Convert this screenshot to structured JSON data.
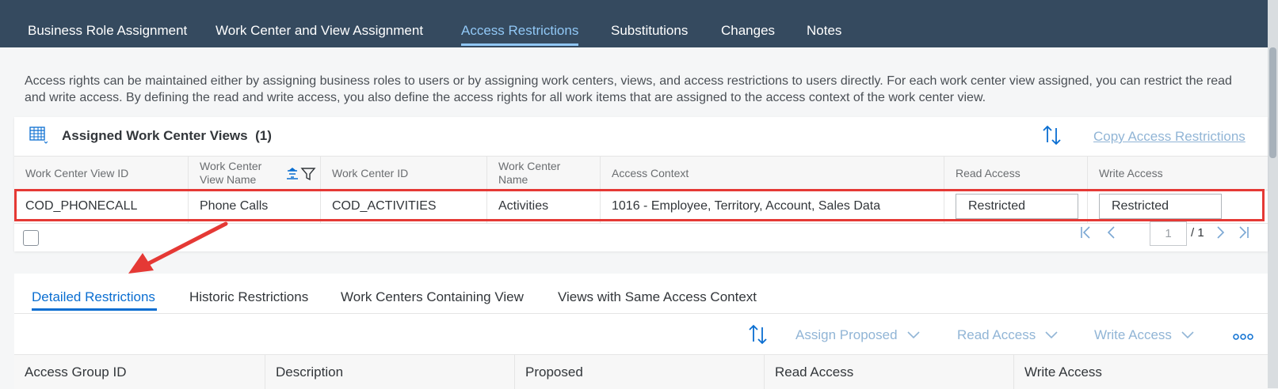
{
  "nav": {
    "tabs": [
      {
        "label": "Business Role Assignment"
      },
      {
        "label": "Work Center and View Assignment"
      },
      {
        "label": "Access Restrictions"
      },
      {
        "label": "Substitutions"
      },
      {
        "label": "Changes"
      },
      {
        "label": "Notes"
      }
    ],
    "active_index": 2
  },
  "intro_text": "Access rights can be maintained either by assigning business roles to users or by assigning work centers, views, and access restrictions to users directly. For each work center view assigned, you can restrict the read and write access. By defining the read and write access, you also define the access rights for all work items that are assigned to the access context of the work center view.",
  "assigned_views": {
    "title": "Assigned Work Center Views",
    "count": "(1)",
    "copy_link": "Copy Access Restrictions",
    "columns": [
      "Work Center View ID",
      "Work Center View Name",
      "Work Center ID",
      "Work Center Name",
      "Access Context",
      "Read Access",
      "Write Access"
    ],
    "rows": [
      {
        "view_id": "COD_PHONECALL",
        "view_name": "Phone Calls",
        "wc_id": "COD_ACTIVITIES",
        "wc_name": "Activities",
        "access_context": "1016 - Employee, Territory, Account, Sales Data",
        "read_access": "Restricted",
        "write_access": "Restricted"
      }
    ],
    "pager": {
      "current": "1",
      "total": "/ 1"
    }
  },
  "details": {
    "tabs": [
      {
        "label": "Detailed Restrictions"
      },
      {
        "label": "Historic Restrictions"
      },
      {
        "label": "Work Centers Containing View"
      },
      {
        "label": "Views with Same Access Context"
      }
    ],
    "active_index": 0,
    "toolbar": {
      "assign_proposed": "Assign Proposed",
      "read_access": "Read Access",
      "write_access": "Write Access"
    },
    "columns": [
      "Access Group ID",
      "Description",
      "Proposed",
      "Read Access",
      "Write Access"
    ]
  },
  "colors": {
    "shell": "#354a5f",
    "active_tab": "#91c8f6",
    "highlight": "#e53935",
    "link": "#0a6ed1"
  }
}
